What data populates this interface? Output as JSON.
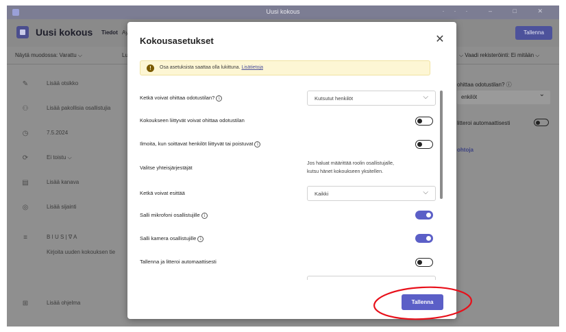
{
  "window": {
    "title": "Uusi kokous",
    "controls": "··· – □ ✕"
  },
  "header": {
    "title": "Uusi kokous",
    "tab_details": "Tiedot",
    "tab_more": "Ay",
    "save_label": "Tallenna"
  },
  "toolbar": {
    "show_as": "Näytä muodossa: Varattu ⌵",
    "category": "Luo",
    "right_text": "⌵    Vaadi rekisteröinti: Ei mitään ⌵"
  },
  "background_form": {
    "rows": [
      {
        "icon": "✎",
        "text": "Lisää otsikko"
      },
      {
        "icon": "⚇",
        "text": "Lisää pakollisia osallistujia"
      },
      {
        "icon": "◷",
        "text": "7.5.2024"
      },
      {
        "icon": "⟳",
        "text": "Ei toistu            ⌵"
      },
      {
        "icon": "▤",
        "text": "Lisää kanava"
      },
      {
        "icon": "◎",
        "text": "Lisää sijainti"
      },
      {
        "icon": "≡",
        "text": "B  I  U  S  |  ∇  A"
      },
      {
        "icon": "",
        "text": "Kirjoita uuden kokouksen tie"
      },
      {
        "icon": "⊞",
        "text": "Lisää ohjelma"
      }
    ],
    "right_panel": {
      "label": "ohittaa odotustilan? ⓘ",
      "value": "enkilöt",
      "toggle_label": "litteroi automaattisesti",
      "link": "ohtoja"
    }
  },
  "modal": {
    "title": "Kokousasetukset",
    "close": "✕",
    "notice": {
      "icon": "!",
      "text": "Osa asetuksista saattaa olla lukittuna.",
      "link": "Lisätietoja"
    },
    "settings": {
      "bypass_lobby": {
        "label": "Ketkä voivat ohittaa odotustilan?",
        "value": "Kutsutut henkilöt",
        "chevron": "⌵"
      },
      "dialin_bypass": {
        "label": "Kokoukseen liittyvät voivat ohittaa odotustilan",
        "state": "off"
      },
      "announce_callers": {
        "label": "Ilmoita, kun soittavat henkilöt liittyvät tai poistuvat",
        "state": "off"
      },
      "co_organizers": {
        "label": "Valitse yhteisjärjestäjät",
        "hint_line1": "Jos haluat määrittää roolin osallistujalle,",
        "hint_line2": "kutsu hänet kokoukseen yksitellen."
      },
      "who_can_present": {
        "label": "Ketkä voivat esittää",
        "value": "Kaikki",
        "chevron": "⌵"
      },
      "allow_mic": {
        "label": "Salli mikrofoni osallistujille",
        "state": "on"
      },
      "allow_camera": {
        "label": "Salli kamera osallistujille",
        "state": "on"
      },
      "record_transcribe": {
        "label": "Tallenna ja litteroi automaattisesti",
        "state": "off"
      }
    },
    "info_glyph": "i",
    "save_label": "Tallenna"
  },
  "colors": {
    "accent": "#5b5fc7",
    "annotation": "#e8101a",
    "notice_bg": "#fdf6d4",
    "overlay": "#8f8f8f"
  },
  "annotation": {
    "type": "red-ellipse",
    "target": "modal-save-button"
  }
}
